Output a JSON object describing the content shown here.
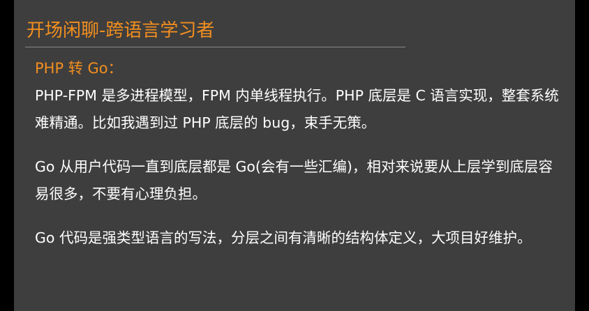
{
  "slide": {
    "title": "开场闲聊-跨语言学习者",
    "subtitle": "PHP 转 Go：",
    "paragraphs": [
      "PHP-FPM 是多进程模型，FPM 内单线程执行。PHP 底层是 C 语言实现，整套系统难精通。比如我遇到过 PHP 底层的 bug，束手无策。",
      "Go 从用户代码一直到底层都是 Go(会有一些汇编)，相对来说要从上层学到底层容易很多，不要有心理负担。",
      "Go 代码是强类型语言的写法，分层之间有清晰的结构体定义，大项目好维护。"
    ]
  },
  "colors": {
    "accent": "#f28f1f",
    "background": "#3f3e3e",
    "text": "#ffffff"
  }
}
